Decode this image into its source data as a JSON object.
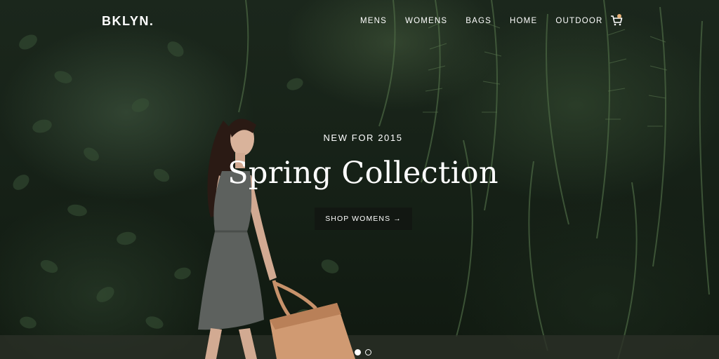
{
  "brand": {
    "logo_text": "BKLYN."
  },
  "nav": {
    "items": [
      {
        "label": "MENS"
      },
      {
        "label": "WOMENS"
      },
      {
        "label": "BAGS"
      },
      {
        "label": "HOME"
      },
      {
        "label": "OUTDOOR"
      }
    ],
    "cart_icon": "cart-icon"
  },
  "hero": {
    "eyebrow": "NEW FOR 2015",
    "headline": "Spring Collection",
    "cta_label": "SHOP WOMENS →",
    "image": "woman-walking-with-tote-bag-by-ivy-wall"
  },
  "slider": {
    "slide_count": 2,
    "active_index": 0
  },
  "colors": {
    "text": "#ffffff",
    "cta_background": "#121612",
    "cart_badge": "#e8b27a"
  }
}
